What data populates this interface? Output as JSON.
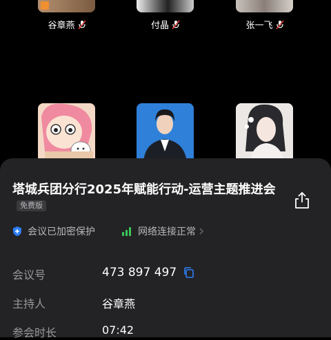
{
  "participants": [
    {
      "name": "谷章燕",
      "mic": "mic-muted-icon",
      "avatar": "orange-photo-avatar"
    },
    {
      "name": "付晶",
      "mic": "mic-muted-icon",
      "avatar": "bw-photo-avatar"
    },
    {
      "name": "张一飞",
      "mic": "mic-muted-icon",
      "avatar": "portrait-avatar"
    },
    {
      "avatar": "cartoon-girl-cat-avatar"
    },
    {
      "avatar": "business-photo-avatar"
    },
    {
      "avatar": "anime-woman-avatar"
    }
  ],
  "meeting": {
    "title": "塔城兵团分行2025年赋能行动-运营主题推进会",
    "badge": "免费版",
    "encryption": "会议已加密保护",
    "network": "网络连接正常"
  },
  "info": {
    "id_label": "会议号",
    "id_value": "473 897 497",
    "host_label": "主持人",
    "host_value": "谷章燕",
    "duration_label": "参会时长",
    "duration_value": "07:42"
  },
  "colors": {
    "sheet": "#232325",
    "accent": "#2d7ef7",
    "network_green": "#3cc85a"
  }
}
